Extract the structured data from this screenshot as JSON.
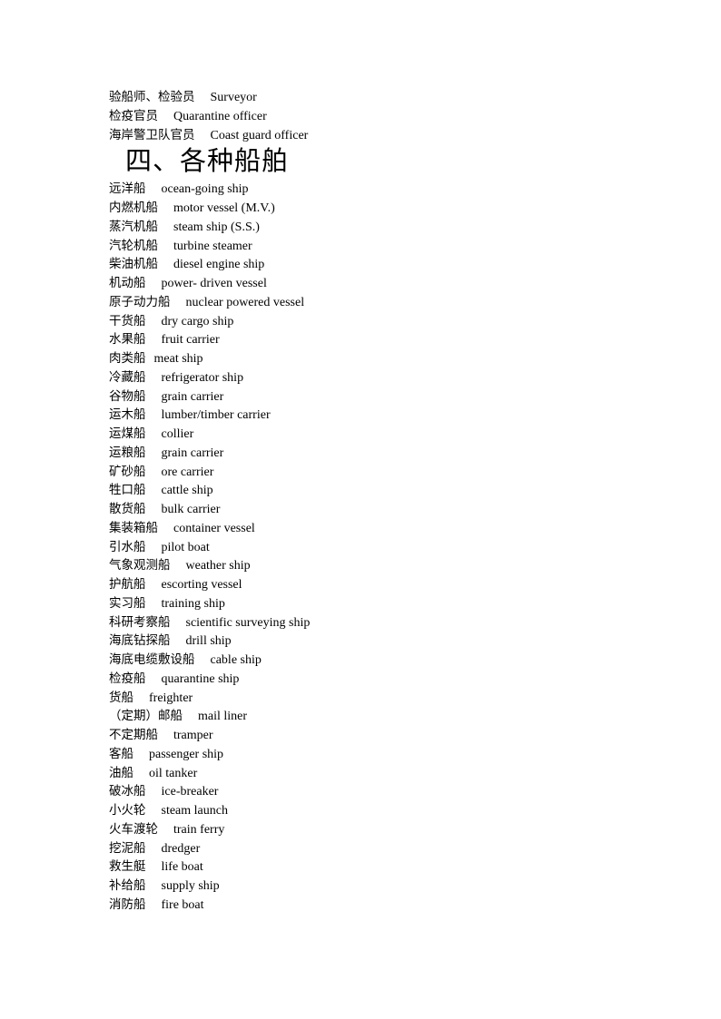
{
  "section_intro": [
    {
      "zh": "验船师、检验员",
      "en": "Surveyor"
    },
    {
      "zh": "检疫官员",
      "en": "Quarantine officer"
    },
    {
      "zh": "海岸警卫队官员",
      "en": "Coast guard officer"
    }
  ],
  "section_heading": "四、各种船舶",
  "ship_types": [
    {
      "zh": "远洋船",
      "en": "ocean-going ship"
    },
    {
      "zh": "内燃机船",
      "en": "motor vessel (M.V.)"
    },
    {
      "zh": "蒸汽机船",
      "en": "steam ship (S.S.)"
    },
    {
      "zh": "汽轮机船",
      "en": "turbine steamer"
    },
    {
      "zh": "柴油机船",
      "en": "diesel engine ship"
    },
    {
      "zh": "机动船",
      "en": "power- driven vessel"
    },
    {
      "zh": "原子动力船",
      "en": "nuclear powered vessel"
    },
    {
      "zh": "干货船",
      "en": "dry cargo ship"
    },
    {
      "zh": "水果船",
      "en": "fruit carrier"
    },
    {
      "zh": "肉类船",
      "en": "meat ship"
    },
    {
      "zh": "冷藏船",
      "en": "refrigerator ship"
    },
    {
      "zh": "谷物船",
      "en": "grain carrier"
    },
    {
      "zh": "运木船",
      "en": "lumber/timber carrier"
    },
    {
      "zh": "运煤船",
      "en": "collier"
    },
    {
      "zh": "运粮船",
      "en": "grain carrier"
    },
    {
      "zh": "矿砂船",
      "en": "ore carrier"
    },
    {
      "zh": "牲口船",
      "en": "cattle ship"
    },
    {
      "zh": "散货船",
      "en": "bulk carrier"
    },
    {
      "zh": "集装箱船",
      "en": "container vessel"
    },
    {
      "zh": "引水船",
      "en": "pilot boat"
    },
    {
      "zh": "气象观测船",
      "en": "weather ship"
    },
    {
      "zh": "护航船",
      "en": "escorting vessel"
    },
    {
      "zh": "实习船",
      "en": "training ship"
    },
    {
      "zh": "科研考察船",
      "en": "scientific surveying ship"
    },
    {
      "zh": "海底钻探船",
      "en": "drill ship"
    },
    {
      "zh": "海底电缆敷设船",
      "en": "cable ship"
    },
    {
      "zh": "检疫船",
      "en": "quarantine ship"
    },
    {
      "zh": "货船",
      "en": "freighter"
    },
    {
      "zh": "（定期）邮船",
      "en": "mail liner"
    },
    {
      "zh": "不定期船",
      "en": "tramper"
    },
    {
      "zh": "客船",
      "en": "passenger ship"
    },
    {
      "zh": "油船",
      "en": "oil tanker"
    },
    {
      "zh": "破冰船",
      "en": "ice-breaker"
    },
    {
      "zh": "小火轮",
      "en": "steam launch"
    },
    {
      "zh": "火车渡轮",
      "en": "train ferry"
    },
    {
      "zh": "挖泥船",
      "en": "dredger"
    },
    {
      "zh": "救生艇",
      "en": "life boat"
    },
    {
      "zh": "补给船",
      "en": "supply ship"
    },
    {
      "zh": "消防船",
      "en": "fire boat"
    }
  ]
}
